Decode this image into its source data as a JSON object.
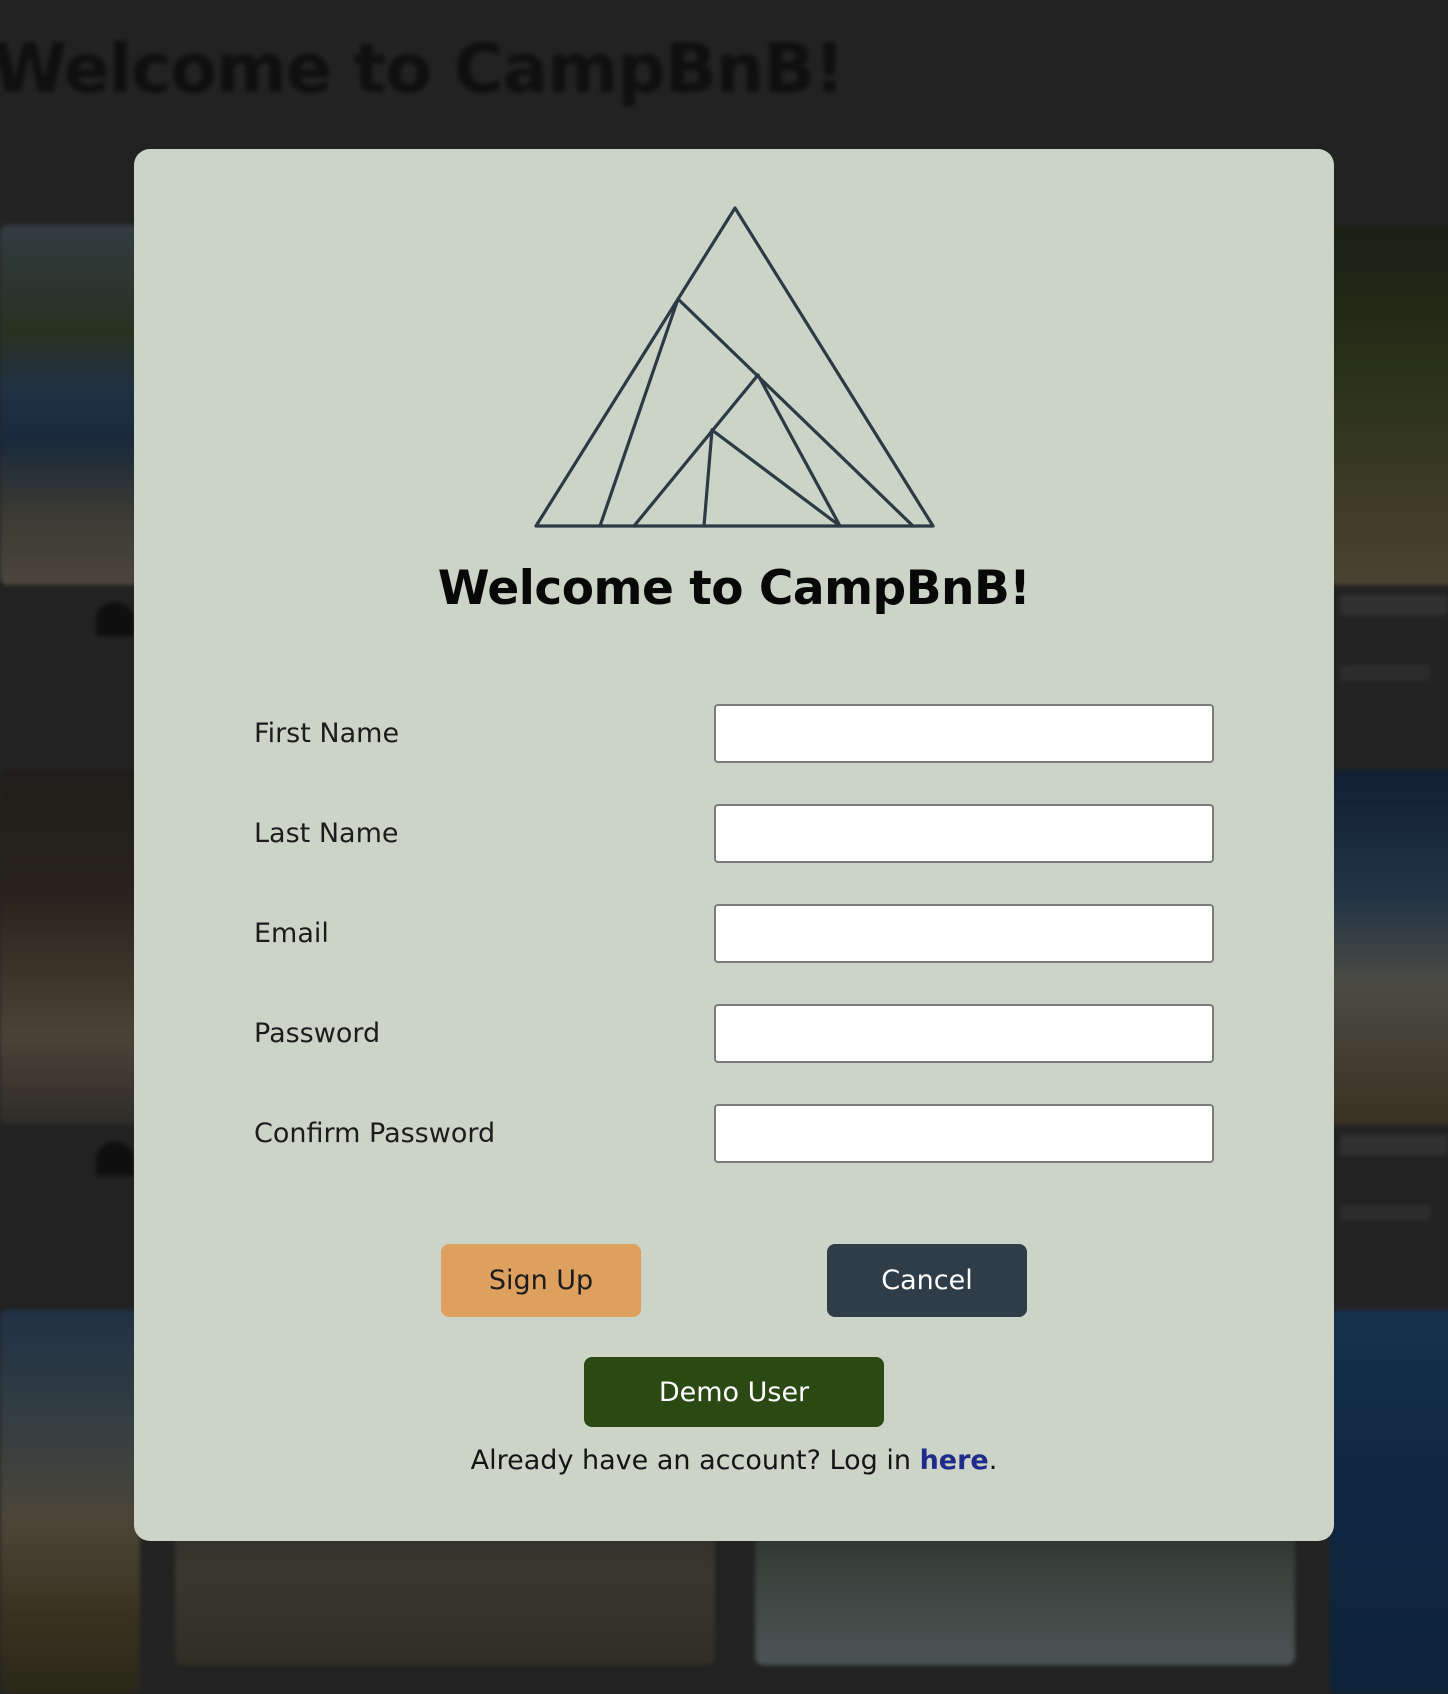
{
  "background": {
    "page_title": "Welcome to CampBnB!"
  },
  "modal": {
    "title": "Welcome to CampBnB!",
    "logo_icon": "mountain-tent-logo-icon",
    "fields": [
      {
        "label": "First Name",
        "value": "",
        "type": "text"
      },
      {
        "label": "Last Name",
        "value": "",
        "type": "text"
      },
      {
        "label": "Email",
        "value": "",
        "type": "email"
      },
      {
        "label": "Password",
        "value": "",
        "type": "password"
      },
      {
        "label": "Confirm Password",
        "value": "",
        "type": "password"
      }
    ],
    "buttons": {
      "signup": "Sign Up",
      "cancel": "Cancel",
      "demo": "Demo User"
    },
    "login_prompt": {
      "text": "Already have an account? Log in ",
      "link": "here",
      "suffix": "."
    }
  },
  "colors": {
    "modal_bg": "#ccd4c7",
    "signup": "#dea05f",
    "cancel": "#2e3d47",
    "demo": "#2b4a13",
    "link": "#1f2b8a"
  }
}
